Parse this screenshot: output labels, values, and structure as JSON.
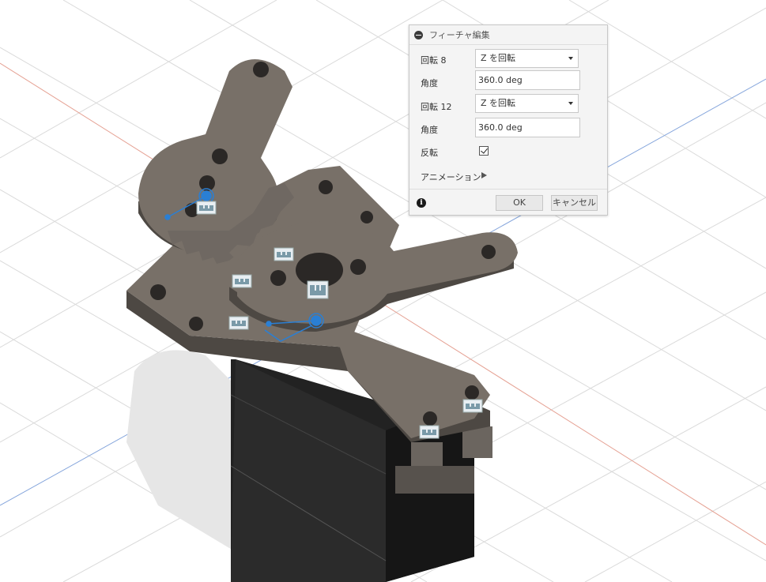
{
  "viewport": {
    "label": "3D model viewport",
    "grid_color": "#d9d9d9",
    "x_axis_color": "#e08a7a",
    "y_axis_color": "#6a8fd6",
    "model_color": "#787068",
    "model_dark": "#4d4843",
    "servo_body_color": "#1c1c1c",
    "joint_color": "#2a7fd4",
    "joint_icon": "joint-glyph-icon"
  },
  "dialog": {
    "title": "フィーチャ編集",
    "collapse_icon": "collapse-icon",
    "rows": [
      {
        "label": "回転 8",
        "value": "Z を回転",
        "type": "select"
      },
      {
        "label": "角度",
        "value": "360.0 deg",
        "type": "input"
      },
      {
        "label": "回転 12",
        "value": "Z を回転",
        "type": "select"
      },
      {
        "label": "角度",
        "value": "360.0 deg",
        "type": "input"
      },
      {
        "label": "反転",
        "checked": true,
        "type": "checkbox"
      },
      {
        "label": "アニメーション",
        "type": "play"
      }
    ],
    "info_icon": "info-icon",
    "ok_label": "OK",
    "cancel_label": "キャンセル"
  }
}
